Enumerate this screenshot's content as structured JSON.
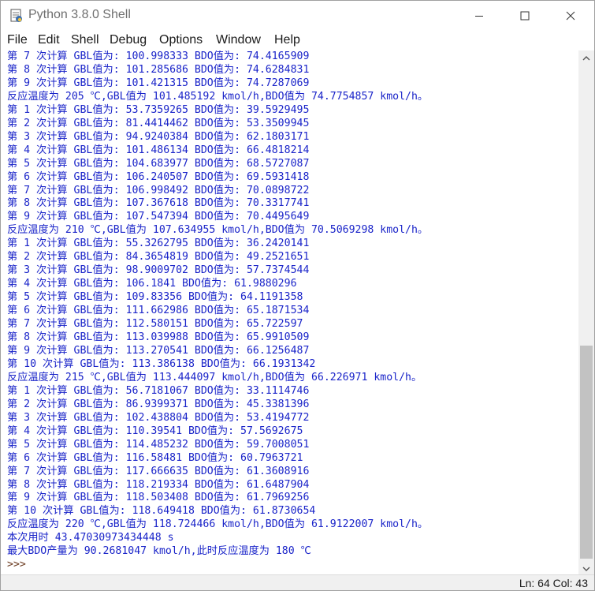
{
  "window": {
    "title": "Python 3.8.0 Shell"
  },
  "menu": {
    "items": [
      "File",
      "Edit",
      "Shell",
      "Debug",
      "Options",
      "Window",
      "Help"
    ]
  },
  "shell": {
    "lines": [
      "第 7 次计算 GBL值为: 100.998333 BDO值为: 74.4165909",
      "第 8 次计算 GBL值为: 101.285686 BDO值为: 74.6284831",
      "第 9 次计算 GBL值为: 101.421315 BDO值为: 74.7287069",
      "反应温度为 205 ℃,GBL值为 101.485192 kmol/h,BDO值为 74.7754857 kmol/h。",
      "第 1 次计算 GBL值为: 53.7359265 BDO值为: 39.5929495",
      "第 2 次计算 GBL值为: 81.4414462 BDO值为: 53.3509945",
      "第 3 次计算 GBL值为: 94.9240384 BDO值为: 62.1803171",
      "第 4 次计算 GBL值为: 101.486134 BDO值为: 66.4818214",
      "第 5 次计算 GBL值为: 104.683977 BDO值为: 68.5727087",
      "第 6 次计算 GBL值为: 106.240507 BDO值为: 69.5931418",
      "第 7 次计算 GBL值为: 106.998492 BDO值为: 70.0898722",
      "第 8 次计算 GBL值为: 107.367618 BDO值为: 70.3317741",
      "第 9 次计算 GBL值为: 107.547394 BDO值为: 70.4495649",
      "反应温度为 210 ℃,GBL值为 107.634955 kmol/h,BDO值为 70.5069298 kmol/h。",
      "第 1 次计算 GBL值为: 55.3262795 BDO值为: 36.2420141",
      "第 2 次计算 GBL值为: 84.3654819 BDO值为: 49.2521651",
      "第 3 次计算 GBL值为: 98.9009702 BDO值为: 57.7374544",
      "第 4 次计算 GBL值为: 106.1841 BDO值为: 61.9880296",
      "第 5 次计算 GBL值为: 109.83356 BDO值为: 64.1191358",
      "第 6 次计算 GBL值为: 111.662986 BDO值为: 65.1871534",
      "第 7 次计算 GBL值为: 112.580151 BDO值为: 65.722597",
      "第 8 次计算 GBL值为: 113.039988 BDO值为: 65.9910509",
      "第 9 次计算 GBL值为: 113.270541 BDO值为: 66.1256487",
      "第 10 次计算 GBL值为: 113.386138 BDO值为: 66.1931342",
      "反应温度为 215 ℃,GBL值为 113.444097 kmol/h,BDO值为 66.226971 kmol/h。",
      "第 1 次计算 GBL值为: 56.7181067 BDO值为: 33.1114746",
      "第 2 次计算 GBL值为: 86.9399371 BDO值为: 45.3381396",
      "第 3 次计算 GBL值为: 102.438804 BDO值为: 53.4194772",
      "第 4 次计算 GBL值为: 110.39541 BDO值为: 57.5692675",
      "第 5 次计算 GBL值为: 114.485232 BDO值为: 59.7008051",
      "第 6 次计算 GBL值为: 116.58481 BDO值为: 60.7963721",
      "第 7 次计算 GBL值为: 117.666635 BDO值为: 61.3608916",
      "第 8 次计算 GBL值为: 118.219334 BDO值为: 61.6487904",
      "第 9 次计算 GBL值为: 118.503408 BDO值为: 61.7969256",
      "第 10 次计算 GBL值为: 118.649418 BDO值为: 61.8730654",
      "反应温度为 220 ℃,GBL值为 118.724466 kmol/h,BDO值为 61.9122007 kmol/h。",
      "本次用时 43.47030973434448 s",
      "最大BDO产量为 90.2681047 kmol/h,此时反应温度为 180 ℃"
    ],
    "prompt": ">>>"
  },
  "status": {
    "position": "Ln: 64  Col: 43"
  },
  "colors": {
    "output_text": "#1a24c9",
    "prompt_text": "#6b3a1f"
  }
}
